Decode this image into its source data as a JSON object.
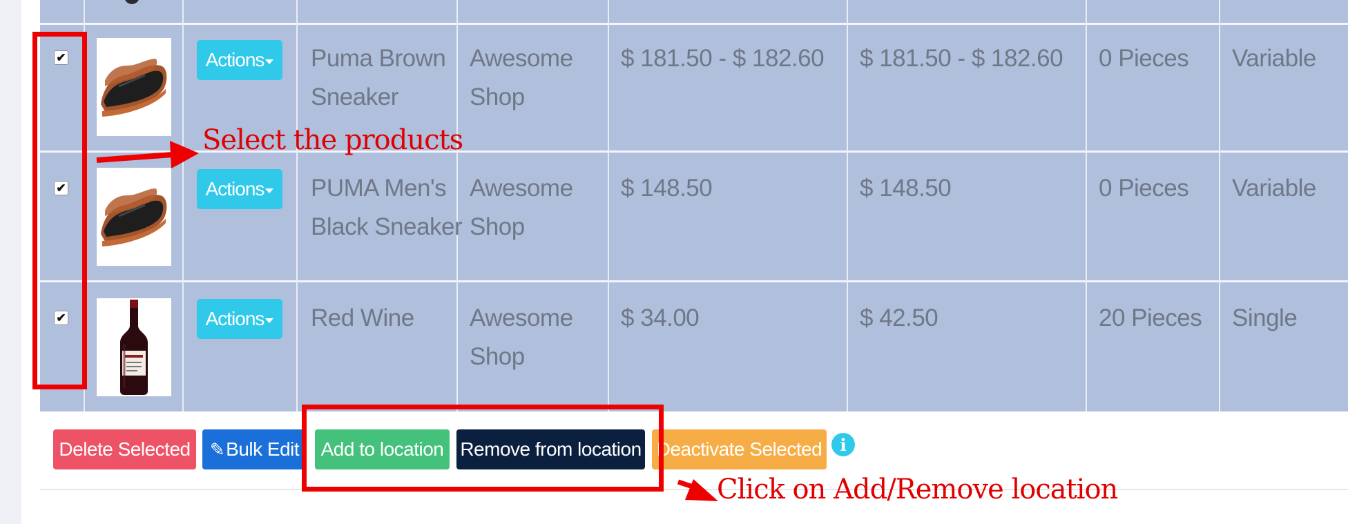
{
  "rows": [
    {
      "actions_label": "Actions",
      "name": [
        "Puma Brown",
        "Sneaker"
      ],
      "location": [
        "Awesome",
        "Shop"
      ],
      "purchase_price": "$ 181.50 - $ 182.60",
      "selling_price": "$ 181.50 - $ 182.60",
      "stock": "0 Pieces",
      "type": "Variable",
      "image_icon": "sneaker-image"
    },
    {
      "actions_label": "Actions",
      "name": [
        "PUMA Men's",
        "Black Sneaker"
      ],
      "location": [
        "Awesome",
        "Shop"
      ],
      "purchase_price": "$ 148.50",
      "selling_price": "$ 148.50",
      "stock": "0 Pieces",
      "type": "Variable",
      "image_icon": "sneaker-image"
    },
    {
      "actions_label": "Actions",
      "name": [
        "Red Wine"
      ],
      "location": [
        "Awesome",
        "Shop"
      ],
      "purchase_price": "$ 34.00",
      "selling_price": "$ 42.50",
      "stock": "20 Pieces",
      "type": "Single",
      "image_icon": "wine-bottle-image"
    }
  ],
  "bulk_actions": {
    "delete_label": "Delete Selected",
    "bulk_edit_label": "Bulk Edit",
    "add_location_label": "Add to location",
    "remove_location_label": "Remove from location",
    "deactivate_label": "Deactivate Selected"
  },
  "annotations": {
    "select_products": "Select the products",
    "click_location": "Click on Add/Remove location"
  },
  "colors": {
    "table_row_bg": "#b0bfdc",
    "actions_btn": "#30c9ea",
    "delete_btn": "#ee5266",
    "bulk_edit_btn": "#1a6fd8",
    "add_location_btn": "#44c17a",
    "remove_location_btn": "#0b1f3f",
    "deactivate_btn": "#f7ad45",
    "annotation_red": "#ee0000"
  },
  "icons": {
    "checkbox": "check-icon",
    "bulk_edit": "edit-icon",
    "info": "info-icon"
  }
}
